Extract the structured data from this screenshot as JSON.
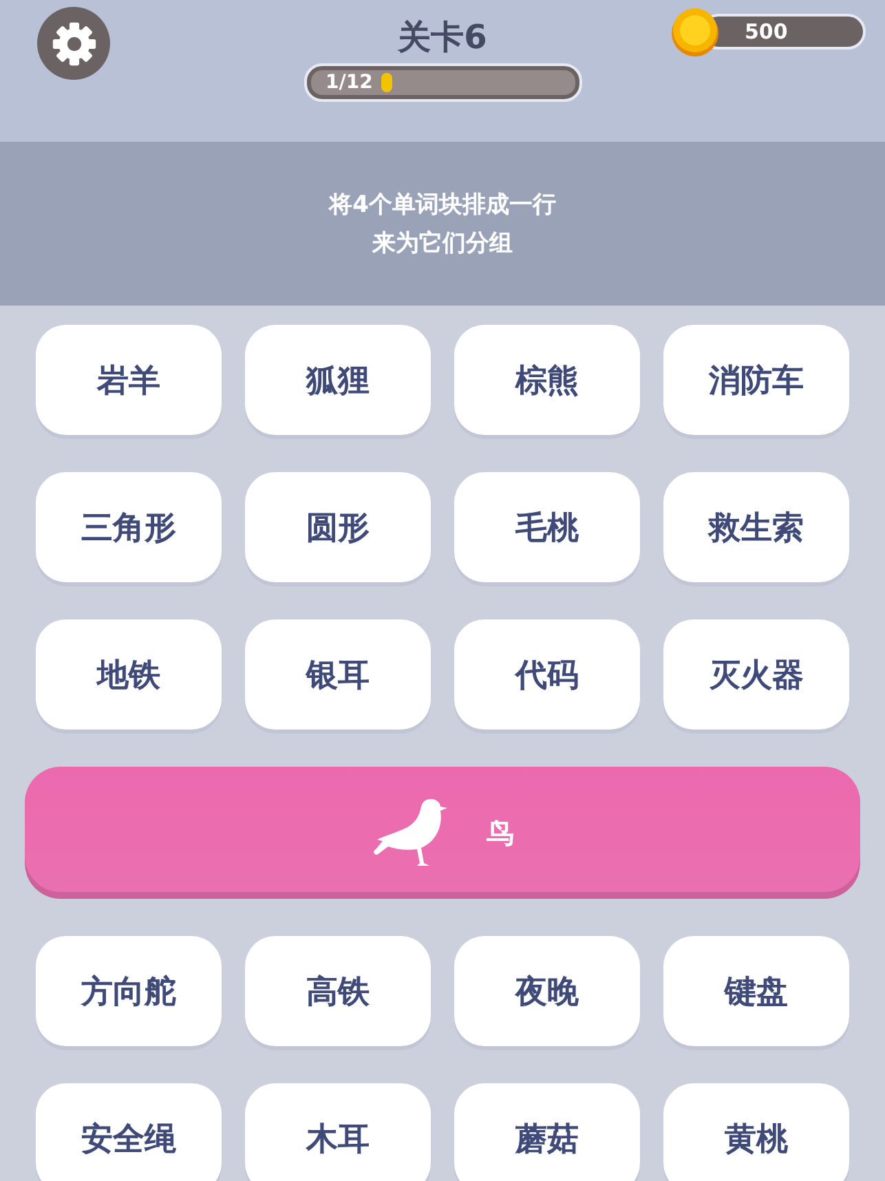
{
  "header": {
    "title": "关卡6",
    "progress": {
      "label": "1/12"
    },
    "coins": "500"
  },
  "instruction": [
    "将4个单词块排成一行",
    "来为它们分组"
  ],
  "board": [
    {
      "kind": "tiles",
      "words": [
        "岩羊",
        "狐狸",
        "棕熊",
        "消防车"
      ]
    },
    {
      "kind": "tiles",
      "words": [
        "三角形",
        "圆形",
        "毛桃",
        "救生索"
      ]
    },
    {
      "kind": "tiles",
      "words": [
        "地铁",
        "银耳",
        "代码",
        "灭火器"
      ]
    },
    {
      "kind": "group",
      "label": "鸟",
      "color": "#ec69ae"
    },
    {
      "kind": "tiles",
      "words": [
        "方向舵",
        "高铁",
        "夜晚",
        "键盘"
      ]
    },
    {
      "kind": "tiles",
      "words": [
        "安全绳",
        "木耳",
        "蘑菇",
        "黄桃"
      ]
    }
  ]
}
